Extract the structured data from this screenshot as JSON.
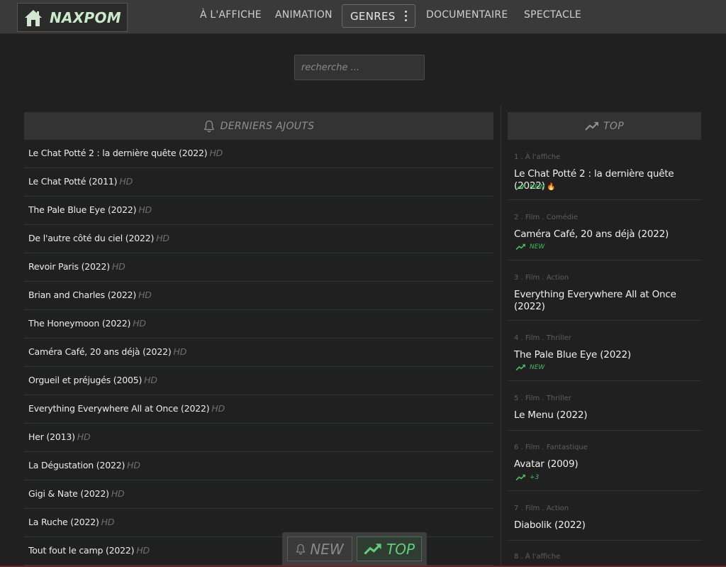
{
  "brand": {
    "name": "NAXPOM"
  },
  "nav": {
    "items": [
      "À L'AFFICHE",
      "ANIMATION",
      "GENRES",
      "DOCUMENTAIRE",
      "SPECTACLE"
    ]
  },
  "search": {
    "placeholder": "recherche ..."
  },
  "latest": {
    "title": "DERNIERS AJOUTS",
    "items": [
      {
        "title": "Le Chat Potté 2 : la dernière quête (2022)",
        "badge": "HD"
      },
      {
        "title": "Le Chat Potté (2011)",
        "badge": "HD"
      },
      {
        "title": "The Pale Blue Eye (2022)",
        "badge": "HD"
      },
      {
        "title": "De l'autre côté du ciel (2022)",
        "badge": "HD"
      },
      {
        "title": "Revoir Paris (2022)",
        "badge": "HD"
      },
      {
        "title": "Brian and Charles (2022)",
        "badge": "HD"
      },
      {
        "title": "The Honeymoon (2022)",
        "badge": "HD"
      },
      {
        "title": "Caméra Café, 20 ans déjà (2022)",
        "badge": "HD"
      },
      {
        "title": "Orgueil et préjugés (2005)",
        "badge": "HD"
      },
      {
        "title": "Everything Everywhere All at Once (2022)",
        "badge": "HD"
      },
      {
        "title": "Her (2013)",
        "badge": "HD"
      },
      {
        "title": "La Dégustation (2022)",
        "badge": "HD"
      },
      {
        "title": "Gigi & Nate (2022)",
        "badge": "HD"
      },
      {
        "title": "La Ruche (2022)",
        "badge": "HD"
      },
      {
        "title": "Tout fout le camp (2022)",
        "badge": "HD"
      }
    ]
  },
  "top": {
    "title": "TOP",
    "items": [
      {
        "meta": "1 . À l'affiche",
        "title": "Le Chat Potté 2 : la dernière quête (2022)",
        "badge": "NEW",
        "fire": "🔥"
      },
      {
        "meta": "2 . Film . Comédie",
        "title": "Caméra Café, 20 ans déjà (2022)",
        "badge": "NEW"
      },
      {
        "meta": "3 . Film . Action",
        "title": "Everything Everywhere All at Once (2022)"
      },
      {
        "meta": "4 . Film . Thriller",
        "title": "The Pale Blue Eye (2022)",
        "badge": "NEW"
      },
      {
        "meta": "5 . Film . Thriller",
        "title": "Le Menu (2022)"
      },
      {
        "meta": "6 . Film . Fantastique",
        "title": "Avatar (2009)",
        "badge": "+3"
      },
      {
        "meta": "7 . Film . Action",
        "title": "Diabolik (2022)"
      },
      {
        "meta": "8 . À l'affiche"
      }
    ]
  },
  "toggle": {
    "new_label": "NEW",
    "top_label": "TOP"
  },
  "colors": {
    "accent_green": "#3fbf5b",
    "background": "#202020",
    "navbar": "#3a3a3a"
  }
}
